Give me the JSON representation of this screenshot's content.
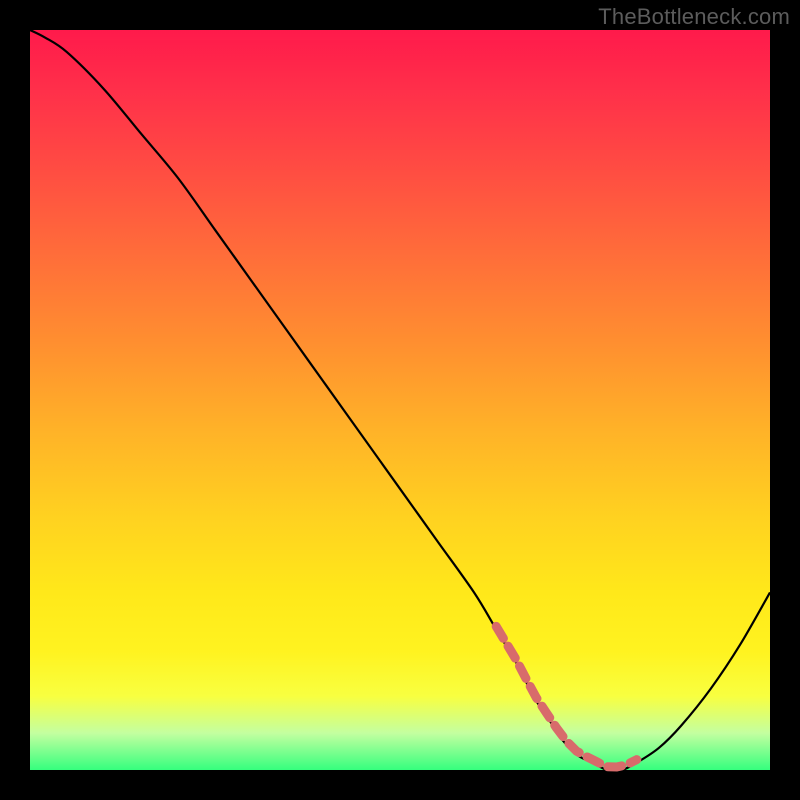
{
  "watermark": "TheBottleneck.com",
  "colors": {
    "gradient_top": "#ff1a4b",
    "gradient_bottom": "#35ff7e",
    "curve": "#000000",
    "marker": "#d86b6b",
    "frame": "#000000"
  },
  "chart_data": {
    "type": "line",
    "title": "",
    "xlabel": "",
    "ylabel": "",
    "xlim": [
      0,
      100
    ],
    "ylim": [
      0,
      100
    ],
    "x": [
      0,
      2,
      5,
      10,
      15,
      20,
      25,
      30,
      35,
      40,
      45,
      50,
      55,
      60,
      63,
      66,
      68,
      70,
      72,
      74,
      76,
      78,
      80,
      82,
      85,
      88,
      92,
      96,
      100
    ],
    "values": [
      100,
      99,
      97,
      92,
      86,
      80,
      73,
      66,
      59,
      52,
      45,
      38,
      31,
      24,
      19,
      14,
      10,
      7,
      4,
      2,
      1,
      0,
      0,
      1,
      3,
      6,
      11,
      17,
      24
    ],
    "series": [
      {
        "name": "curve",
        "x_ref": "x",
        "y_ref": "values"
      }
    ],
    "markers": {
      "band_x_range": [
        63,
        82
      ],
      "band_y": 0
    },
    "notes": "Black V-shaped curve on a vertical red→green gradient; dashed salmon marker band sits at the curve's trough near the bottom."
  }
}
